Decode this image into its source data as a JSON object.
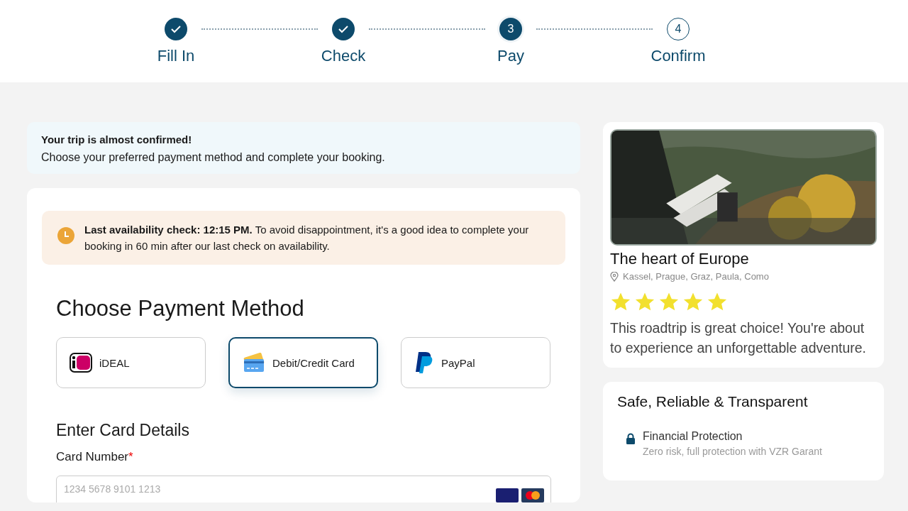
{
  "steps": [
    {
      "label": "Fill In",
      "completed": true,
      "selected": false
    },
    {
      "label": "Check",
      "completed": true,
      "selected": false
    },
    {
      "label": "Pay",
      "completed": false,
      "selected": true,
      "number": "3"
    },
    {
      "label": "Confirm",
      "completed": false,
      "selected": false,
      "number": "4"
    }
  ],
  "intro": {
    "title": "Your trip is almost confirmed!",
    "text": "Choose your preferred payment method and complete your booking."
  },
  "availability": {
    "text": "**Last availability check: 12:15 PM.**  To avoid disappointment, it's a good idea to complete your booking in 60 min after our last check on availability."
  },
  "payment": {
    "title": "Choose Payment Method",
    "methods": [
      {
        "label": "iDEAL",
        "kind": "ideal",
        "selected": false
      },
      {
        "label": "Debit/Credit Card",
        "kind": "card",
        "selected": true
      },
      {
        "label": "PayPal",
        "kind": "paypal",
        "selected": false
      }
    ],
    "card_details": {
      "title": "Enter Card Details",
      "field": {
        "label": "Card Number",
        "required_mark": "*",
        "placeholder": "1234 5678 9101 1213"
      }
    }
  },
  "trip": {
    "title": "The heart of Europe",
    "locations": "Kassel, Prague, Graz, Paula, Como",
    "stars": 5,
    "description": "This roadtrip is great choice! You're about to experience an unforgettable adventure."
  },
  "trust": {
    "title": "Safe, Reliable & Transparent",
    "items": [
      {
        "title": "Financial Protection",
        "text": "Zero risk, full protection with VZR Garant"
      }
    ]
  }
}
